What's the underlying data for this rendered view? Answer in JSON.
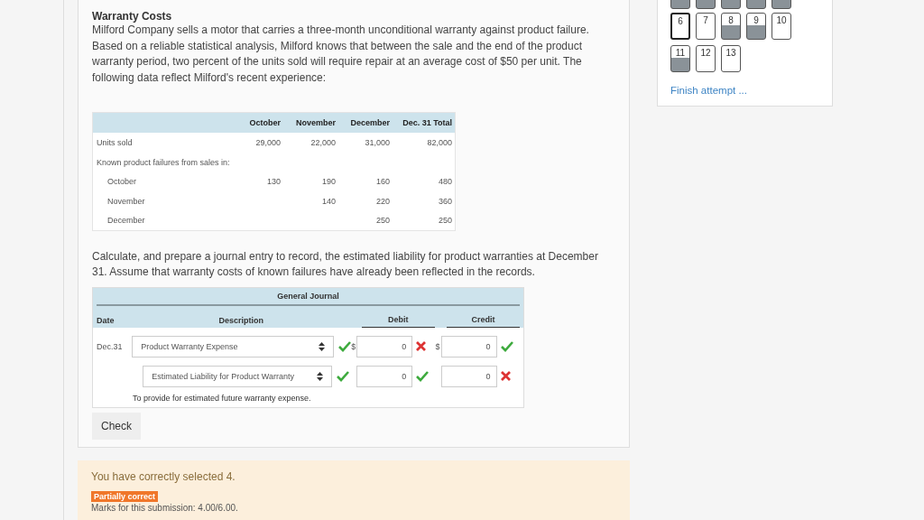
{
  "question": {
    "title": "Warranty Costs",
    "intro": "Milford Company sells a motor that carries a three-month unconditional warranty against product failure. Based on a reliable statistical analysis, Milford knows that between the sale and the end of the product warranty period, two percent of the units sold will require repair at an average cost of $50 per unit. The following data reflect Milford's recent experience:",
    "data_table": {
      "columns": [
        "October",
        "November",
        "December",
        "Dec. 31 Total"
      ],
      "rows": [
        {
          "label": "Units sold",
          "cells": [
            "29,000",
            "22,000",
            "31,000",
            "82,000"
          ]
        },
        {
          "label": "Known product failures from sales in:",
          "children": [
            {
              "label": "October",
              "cells": [
                "130",
                "190",
                "160",
                "480"
              ]
            },
            {
              "label": "November",
              "cells": [
                "",
                "140",
                "220",
                "360"
              ]
            },
            {
              "label": "December",
              "cells": [
                "",
                "",
                "250",
                "250"
              ]
            }
          ]
        }
      ]
    },
    "task": "Calculate, and prepare a journal entry to record, the estimated liability for product warranties at December 31. Assume that warranty costs of known failures have already been reflected in the records.",
    "journal": {
      "title": "General Journal",
      "columns": [
        "Date",
        "Description",
        "Debit",
        "Credit"
      ],
      "rows": [
        {
          "date": "Dec.31",
          "account": "Product Warranty Expense",
          "account_correct": true,
          "debit_sign": "$",
          "debit": "0",
          "debit_correct": false,
          "credit_sign": "$",
          "credit": "0",
          "credit_correct": true
        },
        {
          "account": "Estimated Liability for Product Warranty",
          "account_correct": true,
          "debit": "0",
          "debit_correct": true,
          "credit": "0",
          "credit_correct": false
        }
      ],
      "explanation": "To provide for estimated future warranty expense."
    },
    "check_button": "Check"
  },
  "feedback": {
    "message": "You have correctly selected 4.",
    "badge": "Partially correct",
    "marks": "Marks for this submission: 4.00/6.00."
  },
  "quiz_navigation": {
    "top_row": [
      {
        "answered": true
      },
      {
        "answered": true
      },
      {
        "answered": true
      },
      {
        "answered": true
      },
      {
        "answered": true
      }
    ],
    "items": [
      {
        "label": "6",
        "current": true,
        "answered": false
      },
      {
        "label": "7",
        "current": false,
        "answered": false
      },
      {
        "label": "8",
        "current": false,
        "answered": true
      },
      {
        "label": "9",
        "current": false,
        "answered": true
      },
      {
        "label": "10",
        "current": false,
        "answered": false
      },
      {
        "label": "11",
        "current": false,
        "answered": true
      },
      {
        "label": "12",
        "current": false,
        "answered": false
      },
      {
        "label": "13",
        "current": false,
        "answered": false
      }
    ],
    "finish_link": "Finish attempt ..."
  }
}
